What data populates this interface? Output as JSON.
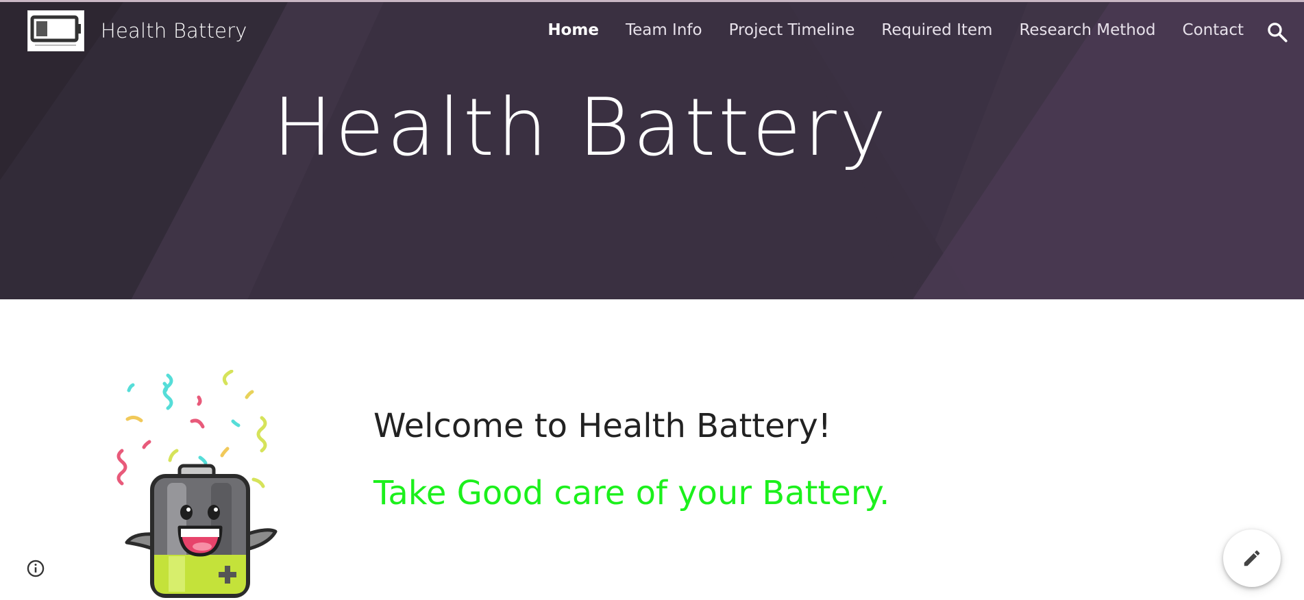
{
  "site": {
    "title": "Health Battery"
  },
  "nav": {
    "items": [
      {
        "label": "Home",
        "active": true
      },
      {
        "label": "Team Info",
        "active": false
      },
      {
        "label": "Project Timeline",
        "active": false
      },
      {
        "label": "Required Item",
        "active": false
      },
      {
        "label": "Research Method",
        "active": false
      },
      {
        "label": "Contact",
        "active": false
      }
    ],
    "search_icon": "search-icon"
  },
  "hero": {
    "title": "Health Battery",
    "background_color": "#3f3446"
  },
  "content": {
    "welcome": "Welcome to Health Battery!",
    "tagline": "Take Good care of your Battery.",
    "tagline_color": "#1cf01c",
    "mascot_icon": "battery-mascot-icon"
  },
  "footer": {
    "info_icon": "info-icon",
    "edit_icon": "pencil-icon"
  }
}
